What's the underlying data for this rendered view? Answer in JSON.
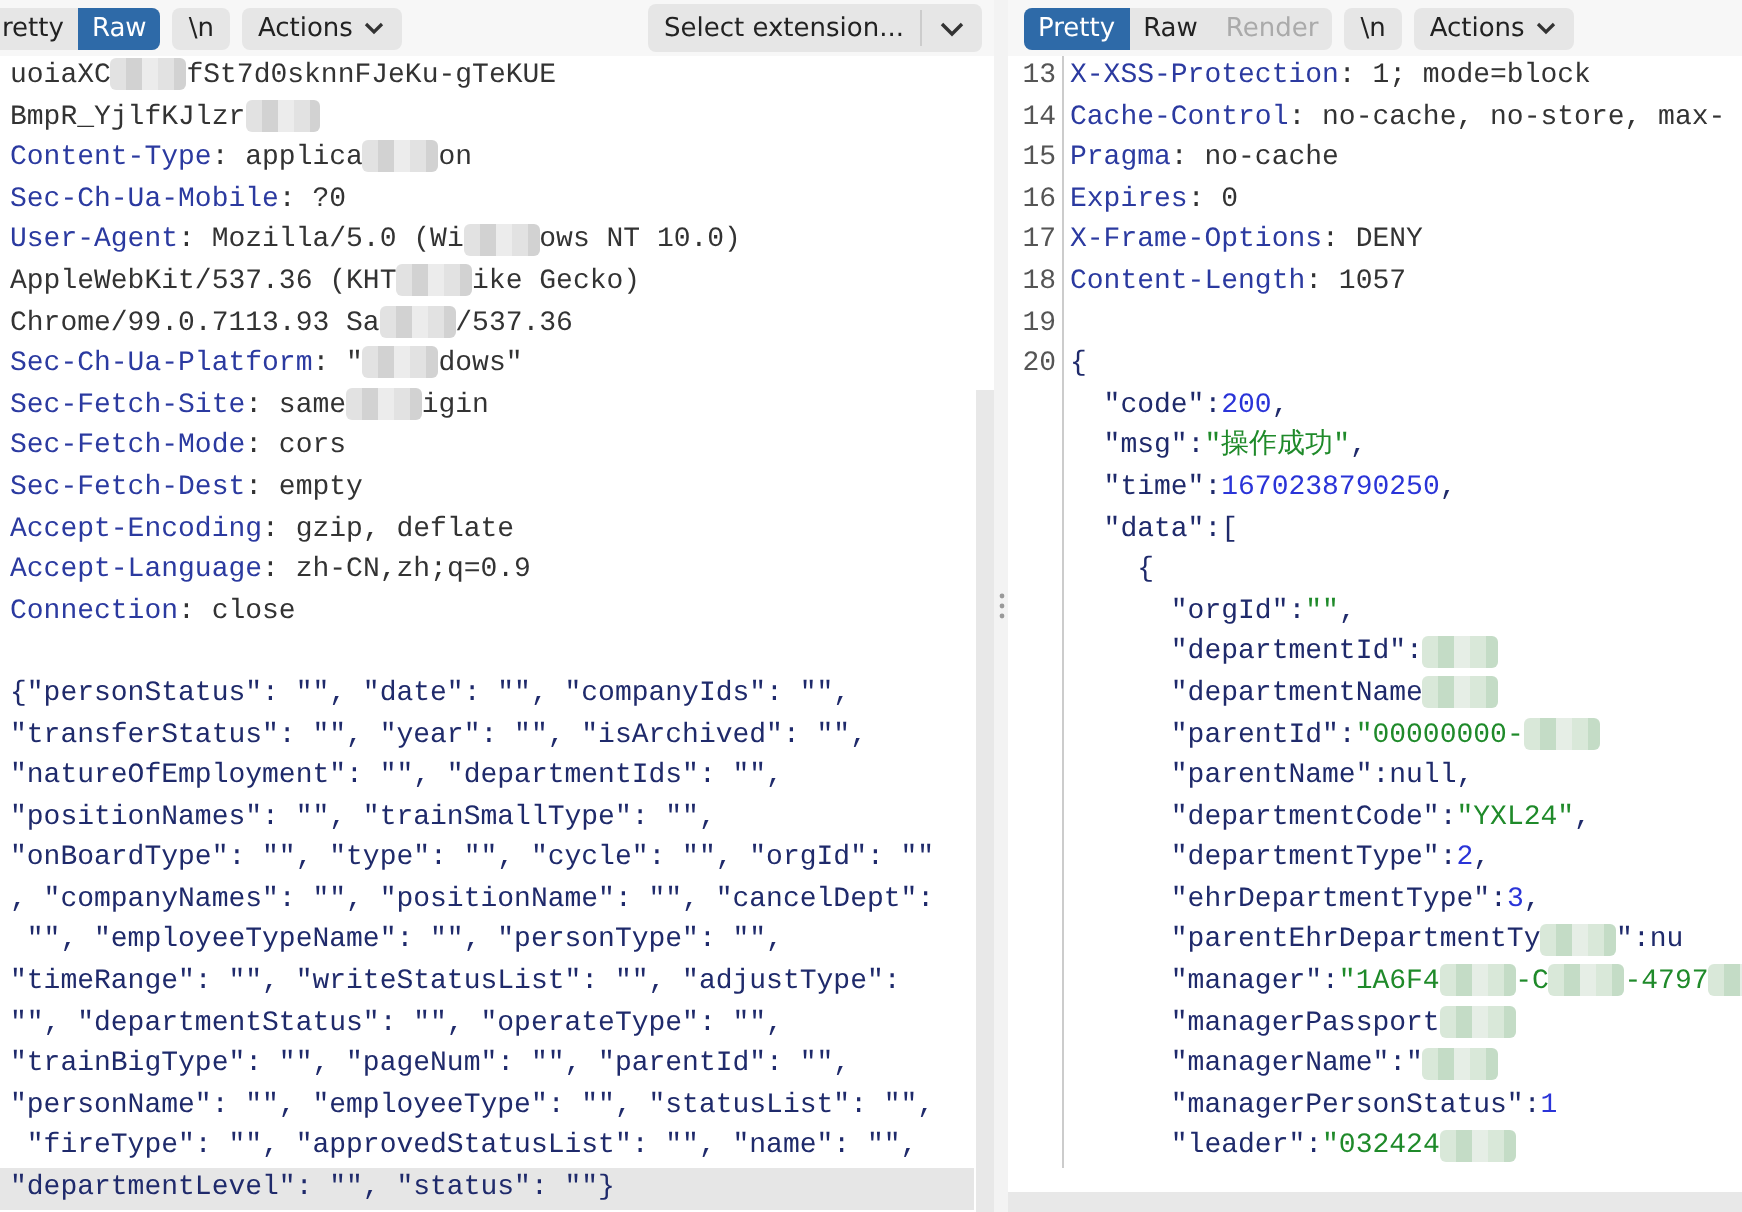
{
  "request": {
    "tabs": [
      {
        "label": "retty",
        "selected": false,
        "disabled": false
      },
      {
        "label": "Raw",
        "selected": true,
        "disabled": false
      }
    ],
    "buttons": [
      {
        "label": "\\n",
        "kind": "toggle"
      },
      {
        "label": "Actions",
        "kind": "menu"
      }
    ],
    "extension_select": {
      "value": "Select extension..."
    },
    "lines": [
      {
        "highlighted": false,
        "parts": [
          {
            "kind": "text",
            "text": "uoiaXC"
          },
          {
            "kind": "redacted"
          },
          {
            "kind": "text",
            "text": "fSt7d0sknnFJeKu-gTeKUE"
          }
        ]
      },
      {
        "highlighted": false,
        "parts": [
          {
            "kind": "text",
            "text": "BmpR_YjlfKJlzr"
          },
          {
            "kind": "redacted"
          }
        ]
      },
      {
        "highlighted": false,
        "parts": [
          {
            "kind": "name",
            "text": "Content-Type"
          },
          {
            "kind": "text",
            "text": ": applica"
          },
          {
            "kind": "redacted"
          },
          {
            "kind": "text",
            "text": "on"
          }
        ]
      },
      {
        "highlighted": false,
        "parts": [
          {
            "kind": "name",
            "text": "Sec-Ch-Ua-Mobile"
          },
          {
            "kind": "text",
            "text": ": ?0"
          }
        ]
      },
      {
        "highlighted": false,
        "parts": [
          {
            "kind": "name",
            "text": "User-Agent"
          },
          {
            "kind": "text",
            "text": ": Mozilla/5.0 (Wi"
          },
          {
            "kind": "redacted"
          },
          {
            "kind": "text",
            "text": "ows NT 10.0)"
          }
        ]
      },
      {
        "highlighted": false,
        "parts": [
          {
            "kind": "text",
            "text": "AppleWebKit/537.36 (KHT"
          },
          {
            "kind": "redacted"
          },
          {
            "kind": "text",
            "text": "ike Gecko)"
          }
        ]
      },
      {
        "highlighted": false,
        "parts": [
          {
            "kind": "text",
            "text": "Chrome/99.0.7113.93 Sa"
          },
          {
            "kind": "redacted"
          },
          {
            "kind": "text",
            "text": "/537.36"
          }
        ]
      },
      {
        "highlighted": false,
        "parts": [
          {
            "kind": "name",
            "text": "Sec-Ch-Ua-Platform"
          },
          {
            "kind": "text",
            "text": ": \""
          },
          {
            "kind": "redacted"
          },
          {
            "kind": "text",
            "text": "dows\""
          }
        ]
      },
      {
        "highlighted": false,
        "parts": [
          {
            "kind": "name",
            "text": "Sec-Fetch-Site"
          },
          {
            "kind": "text",
            "text": ": same"
          },
          {
            "kind": "redacted"
          },
          {
            "kind": "text",
            "text": "igin"
          }
        ]
      },
      {
        "highlighted": false,
        "parts": [
          {
            "kind": "name",
            "text": "Sec-Fetch-Mode"
          },
          {
            "kind": "text",
            "text": ": cors"
          }
        ]
      },
      {
        "highlighted": false,
        "parts": [
          {
            "kind": "name",
            "text": "Sec-Fetch-Dest"
          },
          {
            "kind": "text",
            "text": ": empty"
          }
        ]
      },
      {
        "highlighted": false,
        "parts": [
          {
            "kind": "name",
            "text": "Accept-Encoding"
          },
          {
            "kind": "text",
            "text": ": gzip, deflate"
          }
        ]
      },
      {
        "highlighted": false,
        "parts": [
          {
            "kind": "name",
            "text": "Accept-Language"
          },
          {
            "kind": "text",
            "text": ": zh-CN,zh;q=0.9"
          }
        ]
      },
      {
        "highlighted": false,
        "parts": [
          {
            "kind": "name",
            "text": "Connection"
          },
          {
            "kind": "text",
            "text": ": close"
          }
        ]
      },
      {
        "highlighted": false
      },
      {
        "highlighted": false,
        "parts": [
          {
            "kind": "body",
            "text": "{\"personStatus\": \"\", \"date\": \"\", \"companyIds\": \"\","
          }
        ]
      },
      {
        "highlighted": false,
        "parts": [
          {
            "kind": "body",
            "text": "\"transferStatus\": \"\", \"year\": \"\", \"isArchived\": \"\","
          }
        ]
      },
      {
        "highlighted": false,
        "parts": [
          {
            "kind": "body",
            "text": "\"natureOfEmployment\": \"\", \"departmentIds\": \"\","
          }
        ]
      },
      {
        "highlighted": false,
        "parts": [
          {
            "kind": "body",
            "text": "\"positionNames\": \"\", \"trainSmallType\": \"\","
          }
        ]
      },
      {
        "highlighted": false,
        "parts": [
          {
            "kind": "body",
            "text": "\"onBoardType\": \"\", \"type\": \"\", \"cycle\": \"\", \"orgId\": \"\""
          }
        ]
      },
      {
        "highlighted": false,
        "parts": [
          {
            "kind": "body",
            "text": ", \"companyNames\": \"\", \"positionName\": \"\", \"cancelDept\":"
          }
        ]
      },
      {
        "highlighted": false,
        "parts": [
          {
            "kind": "body",
            "text": " \"\", \"employeeTypeName\": \"\", \"personType\": \"\","
          }
        ]
      },
      {
        "highlighted": false,
        "parts": [
          {
            "kind": "body",
            "text": "\"timeRange\": \"\", \"writeStatusList\": \"\", \"adjustType\":"
          }
        ]
      },
      {
        "highlighted": false,
        "parts": [
          {
            "kind": "body",
            "text": "\"\", \"departmentStatus\": \"\", \"operateType\": \"\","
          }
        ]
      },
      {
        "highlighted": false,
        "parts": [
          {
            "kind": "body",
            "text": "\"trainBigType\": \"\", \"pageNum\": \"\", \"parentId\": \"\","
          }
        ]
      },
      {
        "highlighted": false,
        "parts": [
          {
            "kind": "body",
            "text": "\"personName\": \"\", \"employeeType\": \"\", \"statusList\": \"\","
          }
        ]
      },
      {
        "highlighted": false,
        "parts": [
          {
            "kind": "body",
            "text": " \"fireType\": \"\", \"approvedStatusList\": \"\", \"name\": \"\","
          }
        ]
      },
      {
        "highlighted": true,
        "parts": [
          {
            "kind": "body",
            "text": "\"departmentLevel\": \"\", \"status\": \"\"}"
          }
        ]
      }
    ]
  },
  "response": {
    "tabs": [
      {
        "label": "Pretty",
        "selected": true,
        "disabled": false
      },
      {
        "label": "Raw",
        "selected": false,
        "disabled": false
      },
      {
        "label": "Render",
        "selected": false,
        "disabled": true
      }
    ],
    "buttons": [
      {
        "label": "\\n",
        "kind": "toggle"
      },
      {
        "label": "Actions",
        "kind": "menu"
      }
    ],
    "lines": [
      {
        "number": "13",
        "parts": [
          {
            "kind": "name",
            "text": "X-XSS-Protection"
          },
          {
            "kind": "text",
            "text": ": 1; mode=block"
          }
        ]
      },
      {
        "number": "14",
        "parts": [
          {
            "kind": "name",
            "text": "Cache-Control"
          },
          {
            "kind": "text",
            "text": ": no-cache, no-store, max-"
          }
        ]
      },
      {
        "number": "15",
        "parts": [
          {
            "kind": "name",
            "text": "Pragma"
          },
          {
            "kind": "text",
            "text": ": no-cache"
          }
        ]
      },
      {
        "number": "16",
        "parts": [
          {
            "kind": "name",
            "text": "Expires"
          },
          {
            "kind": "text",
            "text": ": 0"
          }
        ]
      },
      {
        "number": "17",
        "parts": [
          {
            "kind": "name",
            "text": "X-Frame-Options"
          },
          {
            "kind": "text",
            "text": ": DENY"
          }
        ]
      },
      {
        "number": "18",
        "parts": [
          {
            "kind": "name",
            "text": "Content-Length"
          },
          {
            "kind": "text",
            "text": ": 1057"
          }
        ]
      },
      {
        "number": "19"
      },
      {
        "number": "20",
        "parts": [
          {
            "kind": "key",
            "text": "{"
          }
        ]
      },
      {
        "parts": [
          {
            "kind": "key",
            "text": "  \"code\":"
          },
          {
            "kind": "number",
            "text": "200"
          },
          {
            "kind": "key",
            "text": ","
          }
        ]
      },
      {
        "parts": [
          {
            "kind": "key",
            "text": "  \"msg\":"
          },
          {
            "kind": "string",
            "text": "\"操作成功\""
          },
          {
            "kind": "key",
            "text": ","
          }
        ]
      },
      {
        "parts": [
          {
            "kind": "key",
            "text": "  \"time\":"
          },
          {
            "kind": "number",
            "text": "1670238790250"
          },
          {
            "kind": "key",
            "text": ","
          }
        ]
      },
      {
        "parts": [
          {
            "kind": "key",
            "text": "  \"data\":["
          }
        ]
      },
      {
        "parts": [
          {
            "kind": "key",
            "text": "    {"
          }
        ]
      },
      {
        "parts": [
          {
            "kind": "key",
            "text": "      \"orgId\":"
          },
          {
            "kind": "string",
            "text": "\"\""
          },
          {
            "kind": "key",
            "text": ","
          }
        ]
      },
      {
        "parts": [
          {
            "kind": "key",
            "text": "      \"departmentId\":"
          },
          {
            "kind": "redacted"
          }
        ]
      },
      {
        "parts": [
          {
            "kind": "key",
            "text": "      \"departmentName"
          },
          {
            "kind": "redacted"
          }
        ]
      },
      {
        "parts": [
          {
            "kind": "key",
            "text": "      \"parentId\":"
          },
          {
            "kind": "string",
            "text": "\"00000000-"
          },
          {
            "kind": "redacted"
          }
        ]
      },
      {
        "parts": [
          {
            "kind": "key",
            "text": "      \"parentName\":null,"
          }
        ]
      },
      {
        "parts": [
          {
            "kind": "key",
            "text": "      \"departmentCode\":"
          },
          {
            "kind": "string",
            "text": "\"YXL24\""
          },
          {
            "kind": "key",
            "text": ","
          }
        ]
      },
      {
        "parts": [
          {
            "kind": "key",
            "text": "      \"departmentType\":"
          },
          {
            "kind": "number",
            "text": "2"
          },
          {
            "kind": "key",
            "text": ","
          }
        ]
      },
      {
        "parts": [
          {
            "kind": "key",
            "text": "      \"ehrDepartmentType\":"
          },
          {
            "kind": "number",
            "text": "3"
          },
          {
            "kind": "key",
            "text": ","
          }
        ]
      },
      {
        "parts": [
          {
            "kind": "key",
            "text": "      \"parentEhrDepartmentTy"
          },
          {
            "kind": "redacted"
          },
          {
            "kind": "key",
            "text": "\":nu"
          }
        ]
      },
      {
        "parts": [
          {
            "kind": "key",
            "text": "      \"manager\":"
          },
          {
            "kind": "string",
            "text": "\"1A6F4"
          },
          {
            "kind": "redacted"
          },
          {
            "kind": "string",
            "text": "-C"
          },
          {
            "kind": "redacted"
          },
          {
            "kind": "string",
            "text": "-4797"
          },
          {
            "kind": "redacted"
          }
        ]
      },
      {
        "parts": [
          {
            "kind": "key",
            "text": "      \"managerPassport"
          },
          {
            "kind": "redacted"
          }
        ]
      },
      {
        "parts": [
          {
            "kind": "key",
            "text": "      \"managerName\":\""
          },
          {
            "kind": "redacted"
          }
        ]
      },
      {
        "parts": [
          {
            "kind": "key",
            "text": "      \"managerPersonStatus\":"
          },
          {
            "kind": "number",
            "text": "1"
          }
        ]
      },
      {
        "parts": [
          {
            "kind": "key",
            "text": "      \"leader\":"
          },
          {
            "kind": "string",
            "text": "\"032424"
          },
          {
            "kind": "redacted"
          }
        ]
      }
    ]
  }
}
